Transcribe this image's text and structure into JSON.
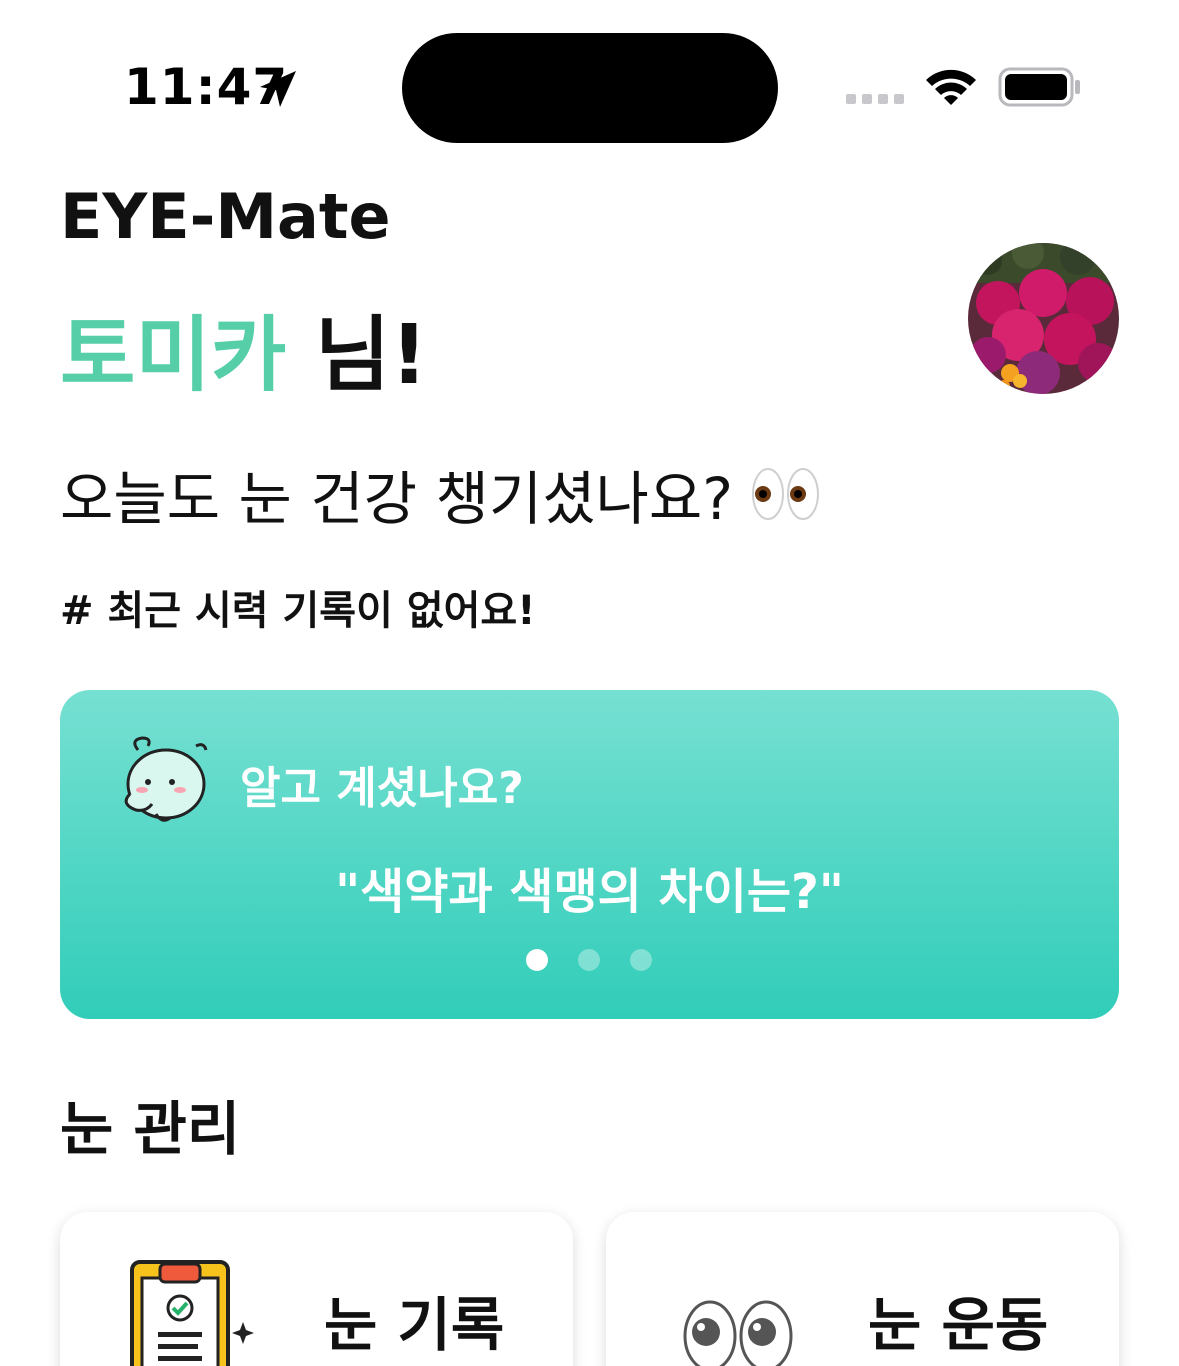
{
  "status_bar": {
    "time": "11:47",
    "icons": [
      "location-arrow-icon",
      "signal-icon",
      "wifi-icon",
      "battery-icon"
    ]
  },
  "header": {
    "app_title": "EYE-Mate",
    "user_name": "토미카",
    "name_suffix": " 님!",
    "subtitle": "오늘도 눈 건강 챙기셨나요?",
    "hashtag": "# 최근 시력 기록이 없어요!"
  },
  "tip_card": {
    "header": "알고 계셨나요?",
    "question": "\"색약과 색맹의 차이는?\"",
    "page_count": 3,
    "active_page": 0
  },
  "eye_care": {
    "section_title": "눈 관리",
    "cards": [
      {
        "title": "눈 기록",
        "subtitle": "",
        "icon": "clipboard-icon"
      },
      {
        "title": "눈 운동",
        "subtitle": "",
        "icon": "eyes-icon"
      }
    ]
  },
  "colors": {
    "accent_green": "#56cfa8",
    "card_gradient_top": "#76e0d2",
    "card_gradient_bottom": "#31cdb9"
  }
}
